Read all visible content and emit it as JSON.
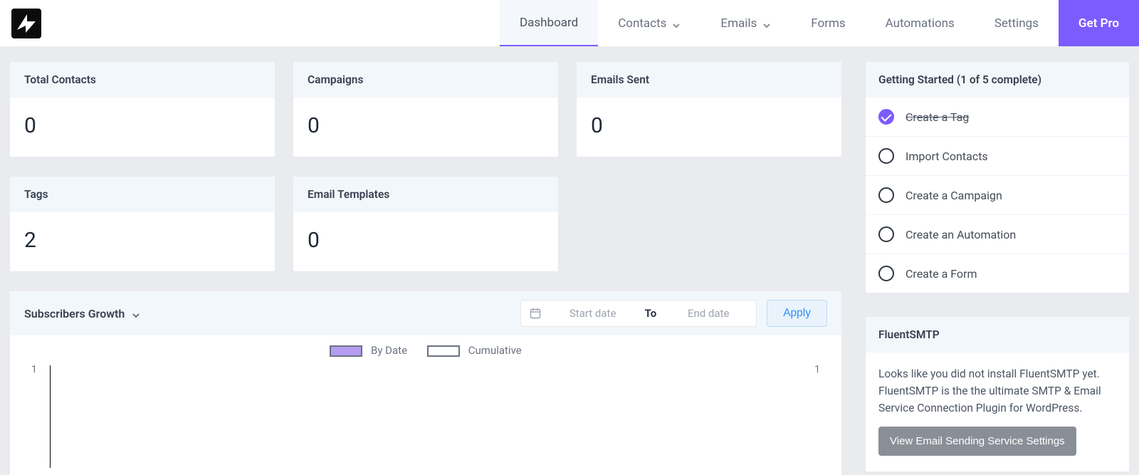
{
  "nav": {
    "items": [
      {
        "label": "Dashboard",
        "hasDropdown": false,
        "active": true
      },
      {
        "label": "Contacts",
        "hasDropdown": true,
        "active": false
      },
      {
        "label": "Emails",
        "hasDropdown": true,
        "active": false
      },
      {
        "label": "Forms",
        "hasDropdown": false,
        "active": false
      },
      {
        "label": "Automations",
        "hasDropdown": false,
        "active": false
      },
      {
        "label": "Settings",
        "hasDropdown": false,
        "active": false
      }
    ],
    "getPro": "Get Pro"
  },
  "stats": {
    "row1": [
      {
        "title": "Total Contacts",
        "value": "0"
      },
      {
        "title": "Campaigns",
        "value": "0"
      },
      {
        "title": "Emails Sent",
        "value": "0"
      }
    ],
    "row2": [
      {
        "title": "Tags",
        "value": "2"
      },
      {
        "title": "Email Templates",
        "value": "0"
      },
      {
        "title": "",
        "value": ""
      }
    ]
  },
  "growth": {
    "title": "Subscribers Growth",
    "startPlaceholder": "Start date",
    "toLabel": "To",
    "endPlaceholder": "End date",
    "applyLabel": "Apply",
    "legend": {
      "byDate": "By Date",
      "cumulative": "Cumulative"
    }
  },
  "chart_data": {
    "type": "line",
    "title": "Subscribers Growth",
    "series": [
      {
        "name": "By Date",
        "values": []
      },
      {
        "name": "Cumulative",
        "values": []
      }
    ],
    "categories": [],
    "ylim_left": [
      0,
      1
    ],
    "ylim_right": [
      0,
      1
    ],
    "y_left_ticks": [
      1
    ],
    "y_right_ticks": [
      1
    ]
  },
  "gettingStarted": {
    "heading": "Getting Started (1 of 5 complete)",
    "items": [
      {
        "label": "Create a Tag",
        "done": true
      },
      {
        "label": "Import Contacts",
        "done": false
      },
      {
        "label": "Create a Campaign",
        "done": false
      },
      {
        "label": "Create an Automation",
        "done": false
      },
      {
        "label": "Create a Form",
        "done": false
      }
    ]
  },
  "smtp": {
    "heading": "FluentSMTP",
    "body": "Looks like you did not install FluentSMTP yet. FluentSMTP is the the ultimate SMTP & Email Service Connection Plugin for WordPress.",
    "button": "View Email Sending Service Settings"
  }
}
